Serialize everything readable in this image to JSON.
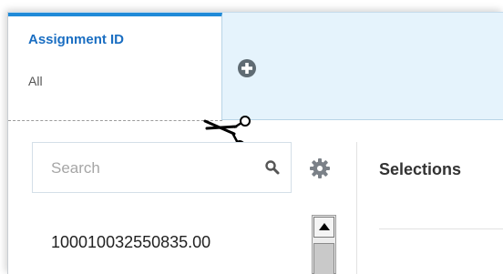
{
  "tab": {
    "title": "Assignment ID",
    "subtitle": "All"
  },
  "icons": {
    "add_tab": "plus-circle-icon",
    "cut": "scissors-icon",
    "search": "search-icon",
    "settings": "gear-icon"
  },
  "search": {
    "placeholder": "Search",
    "value": ""
  },
  "selections_label": "Selections",
  "list": {
    "items": [
      "100010032550835.00"
    ]
  },
  "colors": {
    "accent": "#1f8ad8",
    "tab_title": "#1a6ec2",
    "tabbar_bg": "#e5f3fc"
  }
}
